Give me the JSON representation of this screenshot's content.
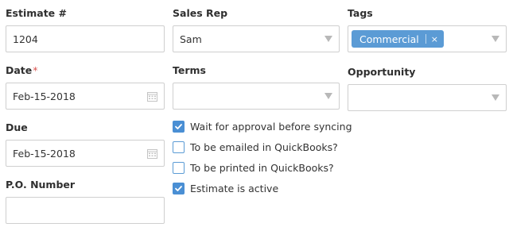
{
  "estimate": {
    "label": "Estimate #",
    "value": "1204"
  },
  "sales_rep": {
    "label": "Sales Rep",
    "value": "Sam"
  },
  "tags": {
    "label": "Tags",
    "items": [
      {
        "label": "Commercial",
        "remove": "×"
      }
    ]
  },
  "date": {
    "label": "Date",
    "required_marker": "*",
    "value": "Feb-15-2018",
    "icon": "calendar-icon"
  },
  "terms": {
    "label": "Terms",
    "value": ""
  },
  "opportunity": {
    "label": "Opportunity",
    "value": ""
  },
  "due": {
    "label": "Due",
    "value": "Feb-15-2018",
    "icon": "calendar-icon"
  },
  "po_number": {
    "label": "P.O. Number",
    "value": ""
  },
  "checkboxes": [
    {
      "label": "Wait for approval before syncing",
      "checked": true
    },
    {
      "label": "To be emailed in QuickBooks?",
      "checked": false
    },
    {
      "label": "To be printed in QuickBooks?",
      "checked": false
    },
    {
      "label": "Estimate is active",
      "checked": true
    }
  ],
  "colors": {
    "accent": "#4a8fd4",
    "tag_bg": "#5b9bd5",
    "required": "#d9534f",
    "border": "#cfcfcf"
  }
}
